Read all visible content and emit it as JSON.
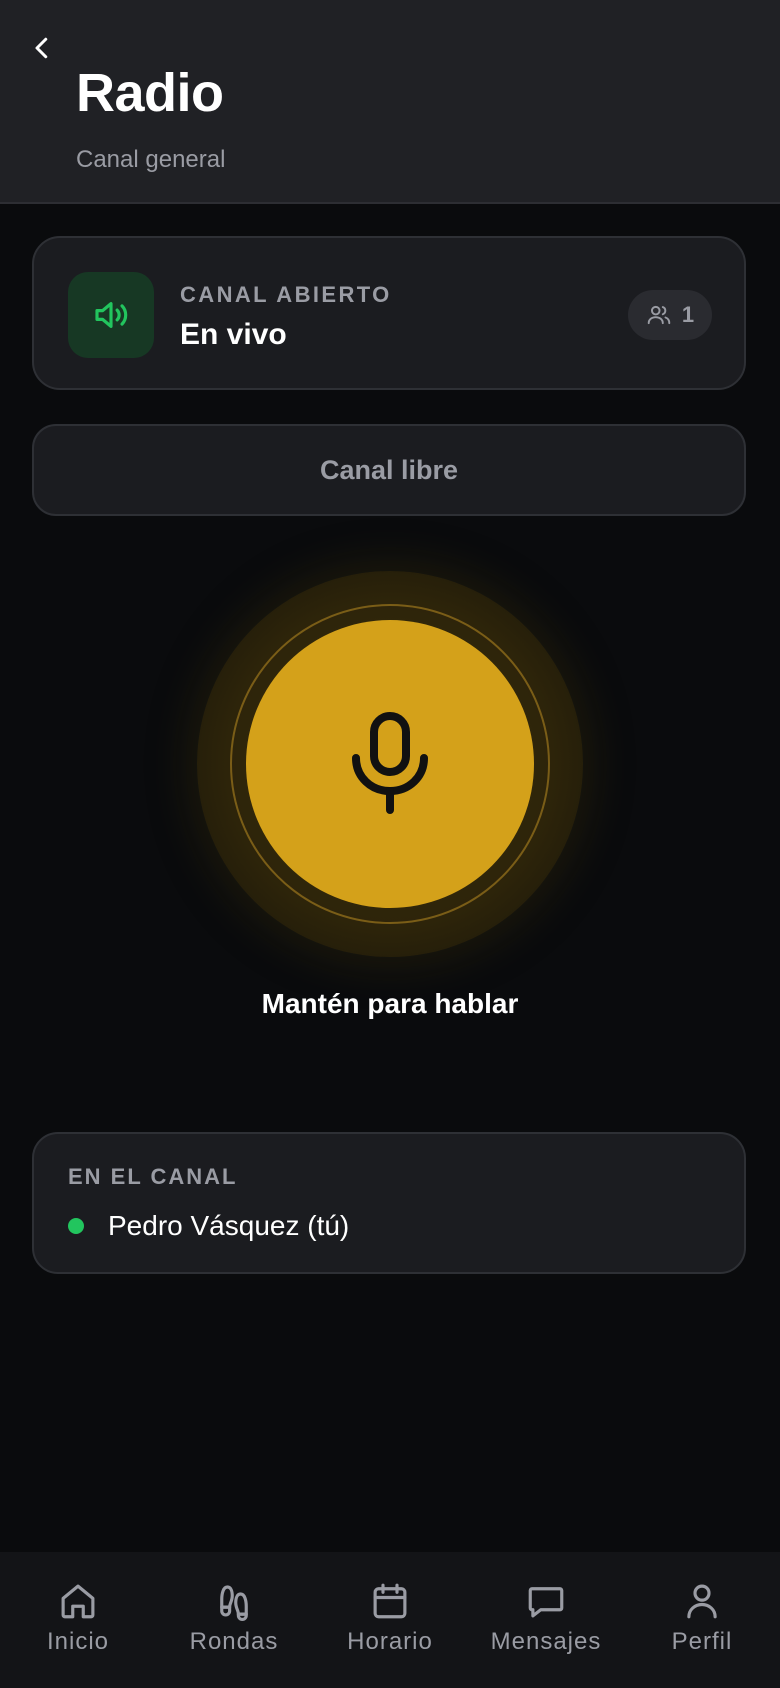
{
  "header": {
    "title": "Radio",
    "subtitle": "Canal general",
    "back_icon": "chevron-left-icon"
  },
  "status_card": {
    "label": "CANAL ABIERTO",
    "value": "En vivo",
    "icon": "speaker-icon",
    "member_count": "1",
    "accent_color": "#22c55e"
  },
  "channel_state": {
    "label": "Canal libre"
  },
  "ptt": {
    "label": "Mantén para hablar",
    "icon": "microphone-icon",
    "color": "#d4a11a"
  },
  "members": {
    "heading": "EN EL CANAL",
    "items": [
      {
        "name": "Pedro Vásquez (tú)",
        "status_color": "#22c55e"
      }
    ]
  },
  "nav": {
    "items": [
      {
        "label": "Inicio",
        "icon": "home-icon"
      },
      {
        "label": "Rondas",
        "icon": "footprints-icon"
      },
      {
        "label": "Horario",
        "icon": "calendar-icon"
      },
      {
        "label": "Mensajes",
        "icon": "message-icon"
      },
      {
        "label": "Perfil",
        "icon": "user-icon"
      }
    ]
  }
}
